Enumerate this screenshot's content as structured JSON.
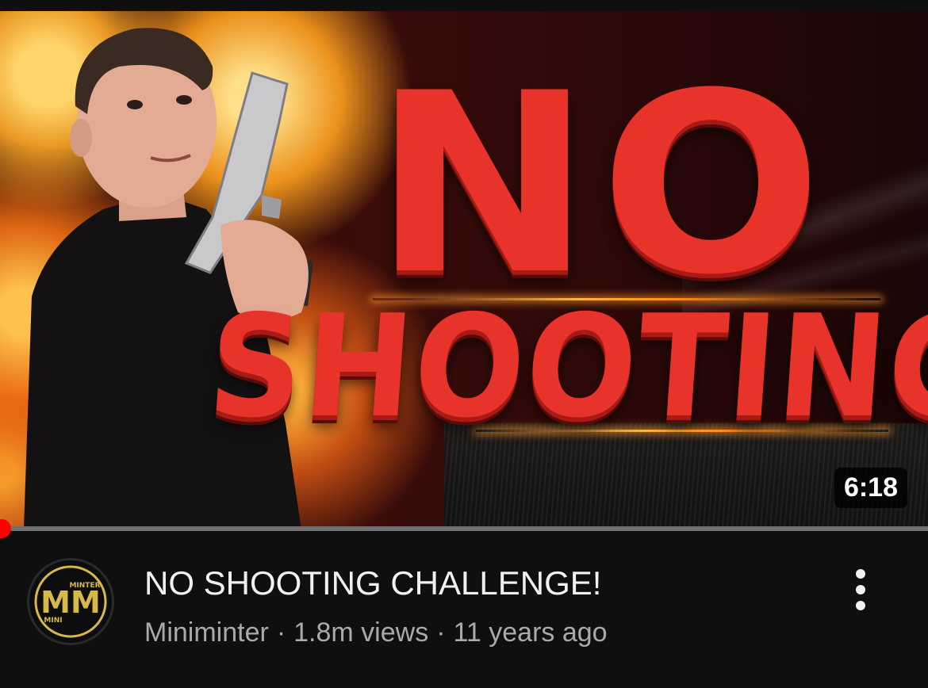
{
  "video": {
    "thumbnail_text": {
      "line1": "NO",
      "line2": "SHOOTING"
    },
    "duration": "6:18",
    "title": "NO SHOOTING CHALLENGE!",
    "channel": "Miniminter",
    "views": "1.8m views",
    "age": "11 years ago",
    "separator": "·",
    "watched_fraction": 0.005,
    "avatar": {
      "logo_letters": "MM",
      "top_text": "MINTER",
      "bottom_text": "MINI"
    },
    "menu_icon": "more-vertical-icon"
  },
  "colors": {
    "background": "#0f0f0f",
    "title": "#f1f1f1",
    "meta": "#aaaaaa",
    "progress": "#ff0000",
    "thumbnail_headline": "#e8332a",
    "logo_gold": "#d9b84a"
  }
}
